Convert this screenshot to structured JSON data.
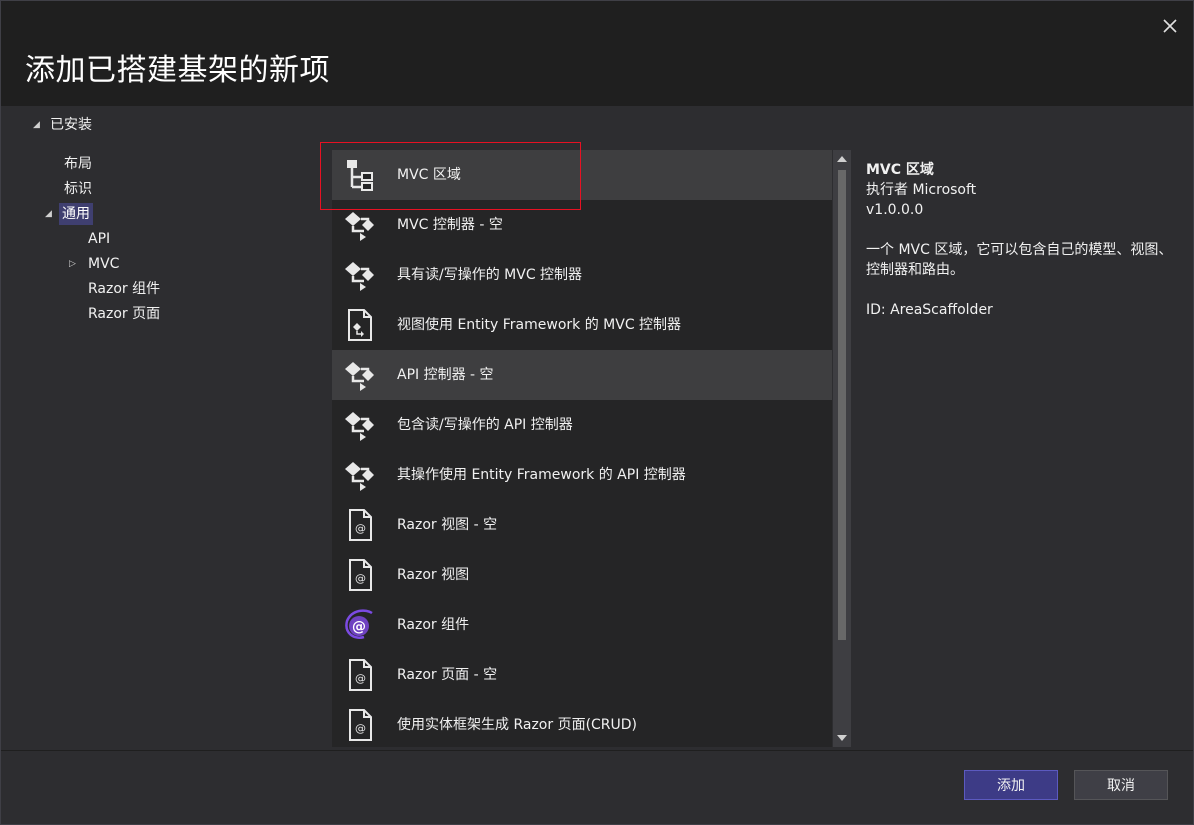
{
  "dialog": {
    "title": "添加已搭建基架的新项",
    "close_label": "✕"
  },
  "tree": {
    "root": "已安装",
    "items": [
      {
        "label": "布局"
      },
      {
        "label": "标识"
      },
      {
        "label": "通用",
        "selected": true
      },
      {
        "label": "API"
      },
      {
        "label": "MVC"
      },
      {
        "label": "Razor 组件"
      },
      {
        "label": "Razor 页面"
      }
    ]
  },
  "templates": [
    {
      "label": "MVC 区域",
      "icon": "area-hierarchy-icon",
      "selected": true
    },
    {
      "label": "MVC 控制器 - 空",
      "icon": "controller-icon"
    },
    {
      "label": "具有读/写操作的 MVC 控制器",
      "icon": "controller-icon"
    },
    {
      "label": "视图使用 Entity Framework 的 MVC 控制器",
      "icon": "file-controller-icon"
    },
    {
      "label": "API 控制器 - 空",
      "icon": "controller-icon",
      "hovered": true
    },
    {
      "label": "包含读/写操作的 API 控制器",
      "icon": "controller-icon"
    },
    {
      "label": "其操作使用 Entity Framework 的 API 控制器",
      "icon": "controller-icon"
    },
    {
      "label": "Razor 视图 - 空",
      "icon": "razor-file-icon"
    },
    {
      "label": "Razor 视图",
      "icon": "razor-file-icon"
    },
    {
      "label": "Razor 组件",
      "icon": "blazor-icon"
    },
    {
      "label": "Razor 页面 - 空",
      "icon": "razor-file-icon"
    },
    {
      "label": "使用实体框架生成 Razor 页面(CRUD)",
      "icon": "razor-file-icon"
    }
  ],
  "details": {
    "name": "MVC 区域",
    "author": "执行者 Microsoft",
    "version": "v1.0.0.0",
    "description": "一个 MVC 区域，它可以包含自己的模型、视图、控制器和路由。",
    "id": "ID: AreaScaffolder"
  },
  "buttons": {
    "add": "添加",
    "cancel": "取消"
  },
  "colors": {
    "accent": "#3d3b86",
    "highlight_box": "#e81123",
    "blazor": "#6f42c1"
  }
}
